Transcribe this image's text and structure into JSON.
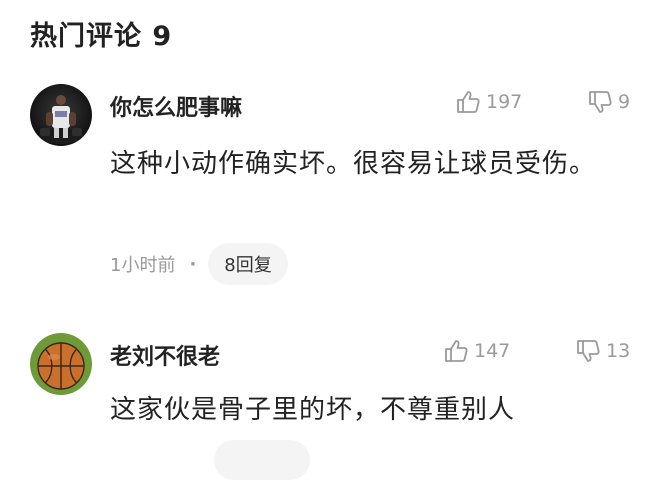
{
  "section": {
    "title": "热门评论 9"
  },
  "comments": [
    {
      "username": "你怎么肥事嘛",
      "like_count": "197",
      "dislike_count": "9",
      "text": "这种小动作确实坏。很容易让球员受伤。",
      "time": "1小时前",
      "separator": "·",
      "replies": "8回复",
      "avatar_icon": "player-photo-avatar"
    },
    {
      "username": "老刘不很老",
      "like_count": "147",
      "dislike_count": "13",
      "text": "这家伙是骨子里的坏，不尊重别人",
      "avatar_icon": "basketball-avatar"
    }
  ],
  "icons": {
    "like": "thumbs-up-icon",
    "dislike": "thumbs-down-icon"
  },
  "colors": {
    "text": "#222222",
    "muted": "#9a9a9a",
    "pill_bg": "#f4f4f4"
  }
}
